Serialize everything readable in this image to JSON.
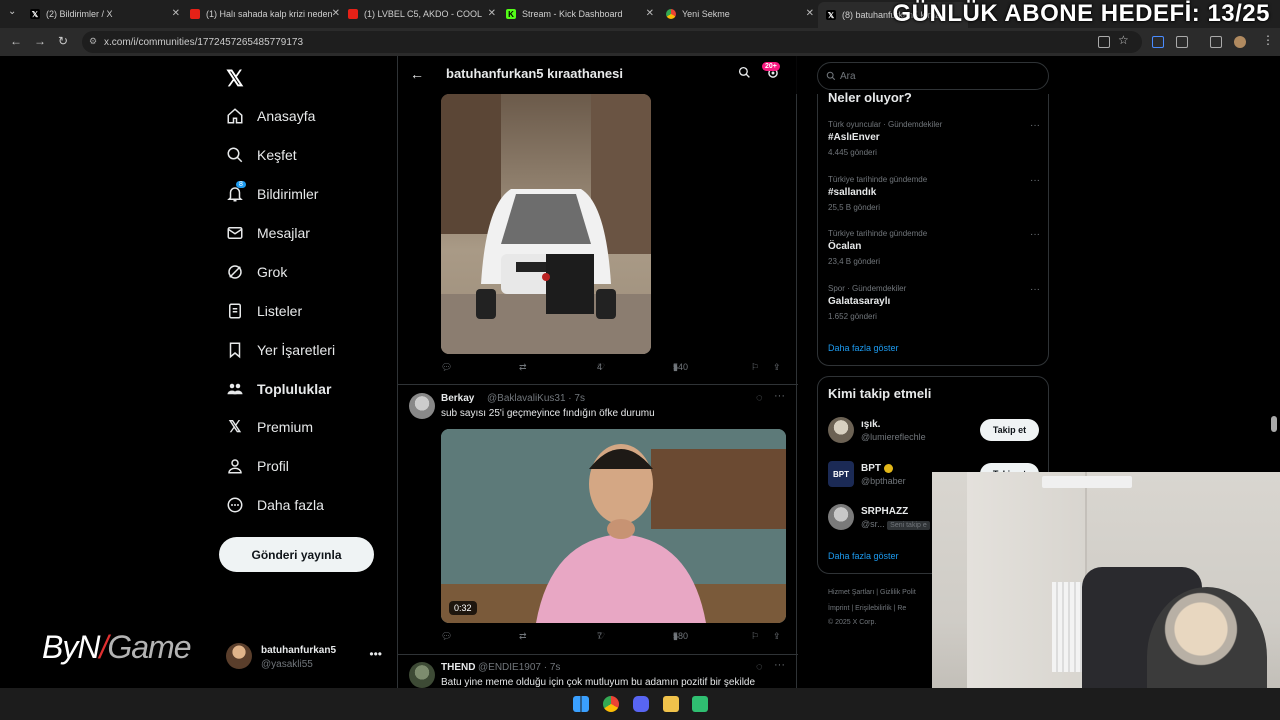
{
  "browser": {
    "tabs": [
      {
        "title": "(2) Bildirimler / X",
        "icon": "x-icon"
      },
      {
        "title": "(1) Halı sahada kalp krizi neden",
        "icon": "youtube-icon"
      },
      {
        "title": "(1) LVBEL C5, AKDO - COOL",
        "icon": "youtube-icon"
      },
      {
        "title": "Stream - Kick Dashboard",
        "icon": "kick-icon"
      },
      {
        "title": "Yeni Sekme",
        "icon": "chrome-icon"
      },
      {
        "title": "(8) batuhanfurkan5 kıraa",
        "icon": "x-icon"
      }
    ],
    "url": "x.com/i/communities/1772457265485779173",
    "overlay_title": "GÜNLÜK ABONE HEDEFİ: 13/25"
  },
  "nav": {
    "items": [
      {
        "label": "Anasayfa",
        "icon": "home-icon",
        "bold": false
      },
      {
        "label": "Keşfet",
        "icon": "search-icon",
        "bold": false
      },
      {
        "label": "Bildirimler",
        "icon": "bell-icon",
        "bold": false,
        "badge": "8"
      },
      {
        "label": "Mesajlar",
        "icon": "mail-icon",
        "bold": false
      },
      {
        "label": "Grok",
        "icon": "grok-icon",
        "bold": false
      },
      {
        "label": "Listeler",
        "icon": "list-icon",
        "bold": false
      },
      {
        "label": "Yer İşaretleri",
        "icon": "bookmark-icon",
        "bold": false
      },
      {
        "label": "Topluluklar",
        "icon": "communities-icon",
        "bold": true
      },
      {
        "label": "Premium",
        "icon": "x-icon",
        "bold": false
      },
      {
        "label": "Profil",
        "icon": "profile-icon",
        "bold": false
      },
      {
        "label": "Daha fazla",
        "icon": "more-circle-icon",
        "bold": false
      }
    ],
    "post_button": "Gönderi yayınla",
    "account": {
      "name": "batuhanfurkan5",
      "handle": "@yasakli55"
    }
  },
  "watermark": {
    "part1": "ByN",
    "part2": "Game"
  },
  "community": {
    "title": "batuhanfurkan5 kıraathanesi",
    "badge": "20+"
  },
  "tweets": [
    {
      "actions": {
        "replies": "",
        "retweets": "",
        "likes": "4",
        "views": "540"
      }
    },
    {
      "name": "Berkay",
      "handle": "@BaklavaliKus31 · 7s",
      "text": "sub sayısı 25'i geçmeyince fındığın öfke durumu",
      "duration": "0:32",
      "actions": {
        "replies": "",
        "retweets": "",
        "likes": "7",
        "views": "580"
      }
    },
    {
      "name": "THEND",
      "handle": "@ENDIE1907 · 7s",
      "text": "Batu yine meme olduğu için çok mutluyum bu adamın pozitif bir şekilde"
    }
  ],
  "right": {
    "search_placeholder": "Ara",
    "trends_title": "Neler oluyor?",
    "trends": [
      {
        "context": "Türk oyuncular · Gündemdekiler",
        "topic": "#AslıEnver",
        "count": "4.445 gönderi"
      },
      {
        "context": "Türkiye tarihinde gündemde",
        "topic": "#sallandık",
        "count": "25,5 B gönderi"
      },
      {
        "context": "Türkiye tarihinde gündemde",
        "topic": "Öcalan",
        "count": "23,4 B gönderi"
      },
      {
        "context": "Spor · Gündemdekiler",
        "topic": "Galatasaraylı",
        "count": "1.652 gönderi"
      }
    ],
    "show_more": "Daha fazla göster",
    "who_title": "Kimi takip etmeli",
    "who": [
      {
        "name": "ışık.",
        "handle": "@lumiereflechle",
        "button": "Takip et"
      },
      {
        "name": "BPT",
        "handle": "@bpthaber",
        "button": "Takip et"
      },
      {
        "name": "SRPHAZZ",
        "handle": "@sr...",
        "button": "Seni takip e"
      }
    ],
    "who_show_more": "Daha fazla göster",
    "footer": {
      "line1": "Hizmet Şartları  |  Gizlilik Polit",
      "line2": "İmprint  |  Erişilebilirlik  |  Re",
      "line3": "© 2025 X Corp."
    }
  },
  "colors": {
    "accent": "#1d9bf0",
    "badge": "#f91880",
    "background": "#000000"
  }
}
